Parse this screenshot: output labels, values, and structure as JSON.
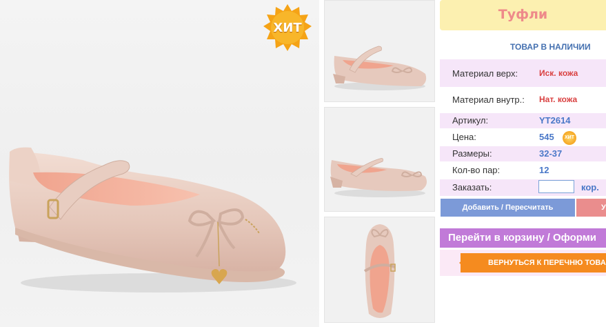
{
  "product": {
    "title": "Туфли",
    "stock_status": "ТОВАР В НАЛИЧИИ",
    "hit_badge": "ХИТ",
    "mini_hit": "ХИТ"
  },
  "details": {
    "material_top_label": "Материал верх:",
    "material_top_value": "Иск. кожа",
    "material_inner_label": "Материал внутр.:",
    "material_inner_value": "Нат. кожа",
    "article_label": "Артикул:",
    "article_value": "YT2614",
    "price_label": "Цена:",
    "price_value": "545",
    "sizes_label": "Размеры:",
    "sizes_value": "32-37",
    "pairs_label": "Кол-во пар:",
    "pairs_value": "12",
    "order_label": "Заказать:",
    "order_input_value": "",
    "order_unit": "кор."
  },
  "buttons": {
    "add_recalc": "Добавить / Пересчитать",
    "delete_partial": "У",
    "go_cart": "Перейти в корзину / Оформи",
    "back_to_list": "ВЕРНУТЬСЯ К ПЕРЕЧНЮ ТОВА"
  },
  "colors": {
    "title_bg": "#fcf0b0",
    "title_text": "#ee8a8a",
    "row_pink": "#f6e6f9",
    "add_button": "#7c9ad8",
    "cart_button": "#c17ad8",
    "back_button": "#f58b1f"
  }
}
